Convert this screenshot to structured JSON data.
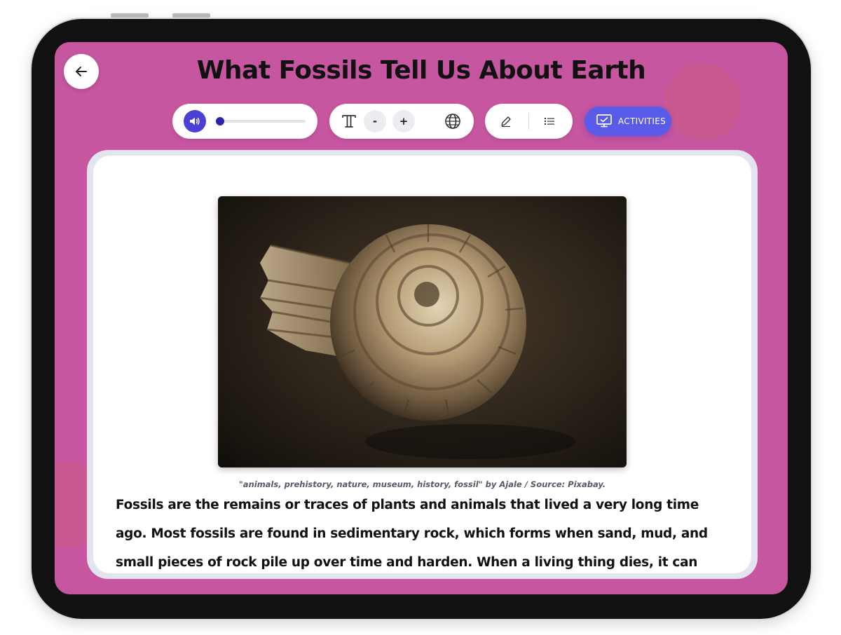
{
  "page": {
    "title": "What Fossils Tell Us About Earth"
  },
  "toolbar": {
    "audio": {
      "progress_fraction": 0.0
    },
    "text_controls": {
      "decrease_label": "-",
      "increase_label": "+"
    },
    "activities_label": "ACTIVITIES"
  },
  "article": {
    "image_caption": "\"animals, prehistory, nature, museum, history, fossil\" by Ajale / Source: Pixabay.",
    "body": "Fossils are the remains or traces of plants and animals that lived a very long time ago. Most fossils are found in sedimentary rock, which forms when sand, mud, and small pieces of rock pile up over time and harden. When a living thing dies, it can"
  },
  "colors": {
    "background": "#c5569f",
    "accent": "#4b3fd6",
    "activities_button": "#5b5bea",
    "text": "#111111"
  },
  "icons": {
    "back": "arrow-left-icon",
    "audio": "speaker-icon",
    "text_size": "text-format-icon",
    "language": "globe-icon",
    "highlight": "pencil-icon",
    "outline": "list-icon",
    "activities": "monitor-icon"
  }
}
